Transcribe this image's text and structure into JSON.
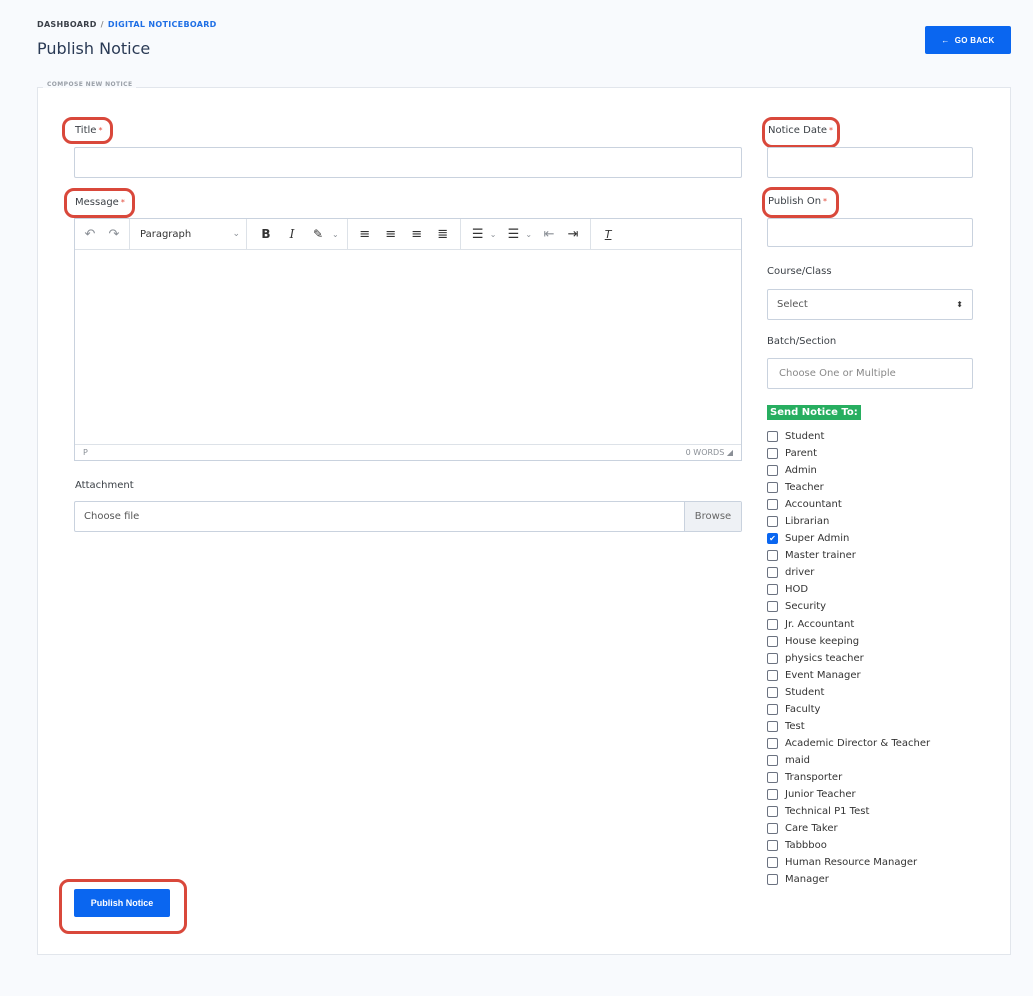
{
  "breadcrumb": {
    "home": "DASHBOARD",
    "separator": "/",
    "current": "DIGITAL NOTICEBOARD"
  },
  "page_title": "Publish Notice",
  "go_back": {
    "icon": "arrow-left-icon",
    "label": "GO BACK"
  },
  "form": {
    "legend": "COMPOSE NEW NOTICE",
    "title_label": "Title",
    "title_value": "",
    "required_mark": "*",
    "message_label": "Message",
    "editor": {
      "paragraph": "Paragraph",
      "status_left": "P",
      "word_count": "0 WORDS"
    },
    "attachment_label": "Attachment",
    "attachment_placeholder": "Choose file",
    "browse_label": "Browse",
    "notice_date_label": "Notice Date",
    "notice_date_value": "",
    "publish_on_label": "Publish On",
    "publish_on_value": "",
    "course_label": "Course/Class",
    "course_selected": "Select",
    "batch_label": "Batch/Section",
    "batch_placeholder": "Choose One or Multiple",
    "send_to_label": "Send Notice To:",
    "roles": [
      {
        "label": "Student",
        "checked": false
      },
      {
        "label": "Parent",
        "checked": false
      },
      {
        "label": "Admin",
        "checked": false
      },
      {
        "label": "Teacher",
        "checked": false
      },
      {
        "label": "Accountant",
        "checked": false
      },
      {
        "label": "Librarian",
        "checked": false
      },
      {
        "label": "Super Admin",
        "checked": true
      },
      {
        "label": "Master trainer",
        "checked": false
      },
      {
        "label": "driver",
        "checked": false
      },
      {
        "label": "HOD",
        "checked": false
      },
      {
        "label": "Security",
        "checked": false
      },
      {
        "label": "Jr. Accountant",
        "checked": false
      },
      {
        "label": "House keeping",
        "checked": false
      },
      {
        "label": "physics teacher",
        "checked": false
      },
      {
        "label": "Event Manager",
        "checked": false
      },
      {
        "label": "Student",
        "checked": false
      },
      {
        "label": "Faculty",
        "checked": false
      },
      {
        "label": "Test",
        "checked": false
      },
      {
        "label": "Academic Director & Teacher",
        "checked": false
      },
      {
        "label": "maid",
        "checked": false
      },
      {
        "label": "Transporter",
        "checked": false
      },
      {
        "label": "Junior Teacher",
        "checked": false
      },
      {
        "label": "Technical P1 Test",
        "checked": false
      },
      {
        "label": "Care Taker",
        "checked": false
      },
      {
        "label": "Tabbboo",
        "checked": false
      },
      {
        "label": "Human Resource Manager",
        "checked": false
      },
      {
        "label": "Manager",
        "checked": false
      }
    ],
    "submit_label": "Publish Notice"
  },
  "colors": {
    "accent": "#0a66f0",
    "highlight": "#d9483b",
    "badge": "#27ae60"
  }
}
